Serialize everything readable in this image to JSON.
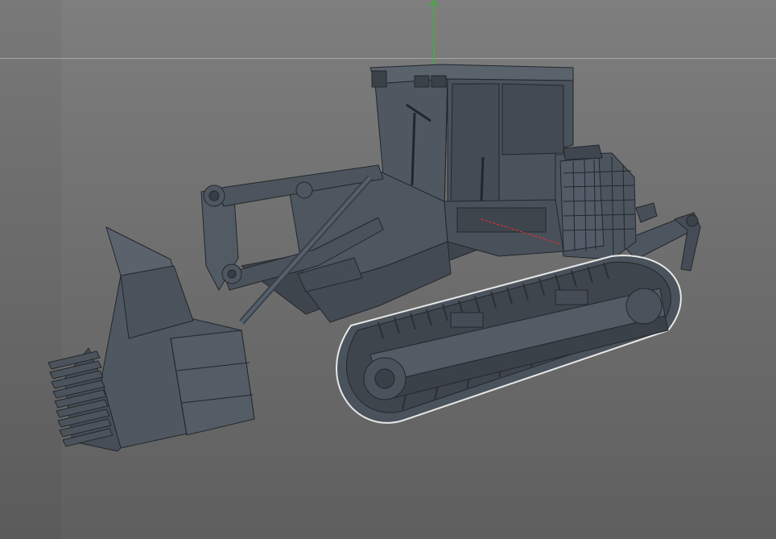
{
  "viewport": {
    "view": "perspective",
    "display_mode": "shaded-wireframe"
  },
  "scene": {
    "object": "tracked-loader-3d-model",
    "selection": "right-track-assembly",
    "axes": {
      "y_axis_color": "#2fbf2f",
      "x_axis_color": "#e03030"
    }
  },
  "colors": {
    "background_top": "#7e7e7e",
    "background_bottom": "#5f5f5f",
    "model_fill": "#4a525c",
    "wire": "#23272c",
    "selection_outline": "#e8e8e8"
  }
}
